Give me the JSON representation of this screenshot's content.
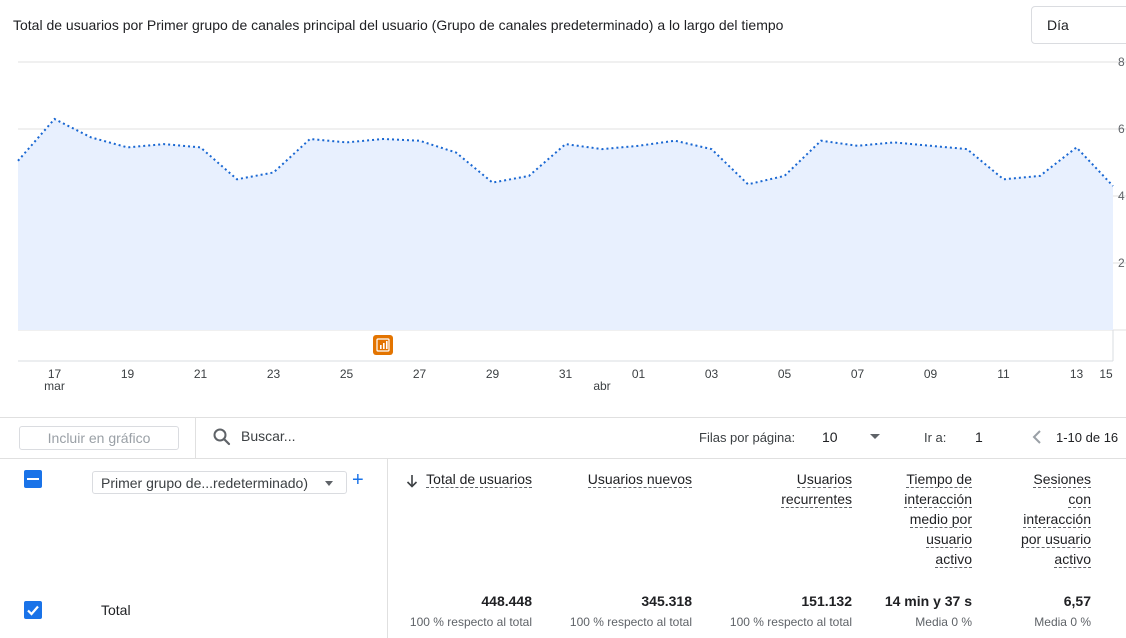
{
  "chart_title": "Total de usuarios por Primer grupo de canales principal del usuario (Grupo de canales predeterminado) a lo largo del tiempo",
  "period_select": {
    "value": "Día"
  },
  "chart_data": {
    "type": "area",
    "y_ticks": [
      "8",
      "6",
      "4",
      "2"
    ],
    "x_ticks": [
      "17",
      "19",
      "21",
      "23",
      "25",
      "27",
      "29",
      "31",
      "01",
      "03",
      "05",
      "07",
      "09",
      "11",
      "13",
      "15"
    ],
    "x_month_labels": [
      "mar",
      "abr"
    ],
    "y_axis_max": 8,
    "y_note": "values in thousands of users per day (axis labels partially cut off)",
    "series": [
      {
        "values": [
          5.05,
          6.3,
          5.75,
          5.45,
          5.55,
          5.45,
          4.5,
          4.7,
          5.7,
          5.6,
          5.7,
          5.65,
          5.3,
          4.4,
          4.6,
          5.55,
          5.4,
          5.5,
          5.65,
          5.4,
          4.35,
          4.6,
          5.65,
          5.5,
          5.6,
          5.5,
          5.4,
          4.5,
          4.6,
          5.45,
          4.3
        ]
      }
    ],
    "annotation_icon": "annotation-icon"
  },
  "toolbar": {
    "include_label": "Incluir en gráfico",
    "search_placeholder": "Buscar...",
    "rows_label": "Filas por página:",
    "rows_value": "10",
    "goto_label": "Ir a:",
    "goto_value": "1",
    "range_text": "1-10 de 16"
  },
  "table": {
    "dimension_select": "Primer grupo de...redeterminado)",
    "columns": [
      {
        "lines": [
          "Total de usuarios"
        ]
      },
      {
        "lines": [
          "Usuarios nuevos"
        ]
      },
      {
        "lines": [
          "Usuarios",
          "recurrentes"
        ]
      },
      {
        "lines": [
          "Tiempo de",
          "interacción",
          "medio por",
          "usuario",
          "activo"
        ]
      },
      {
        "lines": [
          "Sesiones",
          "con",
          "interacción",
          "por usuario",
          "activo"
        ]
      }
    ],
    "total_row": {
      "label": "Total",
      "values": [
        "448.448",
        "345.318",
        "151.132",
        "14 min y 37 s",
        "6,57"
      ],
      "subs": [
        "100 % respecto al total",
        "100 % respecto al total",
        "100 % respecto al total",
        "Media 0 %",
        "Media 0 %"
      ]
    }
  },
  "colors": {
    "accent": "#1a73e8",
    "line": "#1967d2",
    "area": "#e8f0fe",
    "annotation": "#e37400"
  }
}
